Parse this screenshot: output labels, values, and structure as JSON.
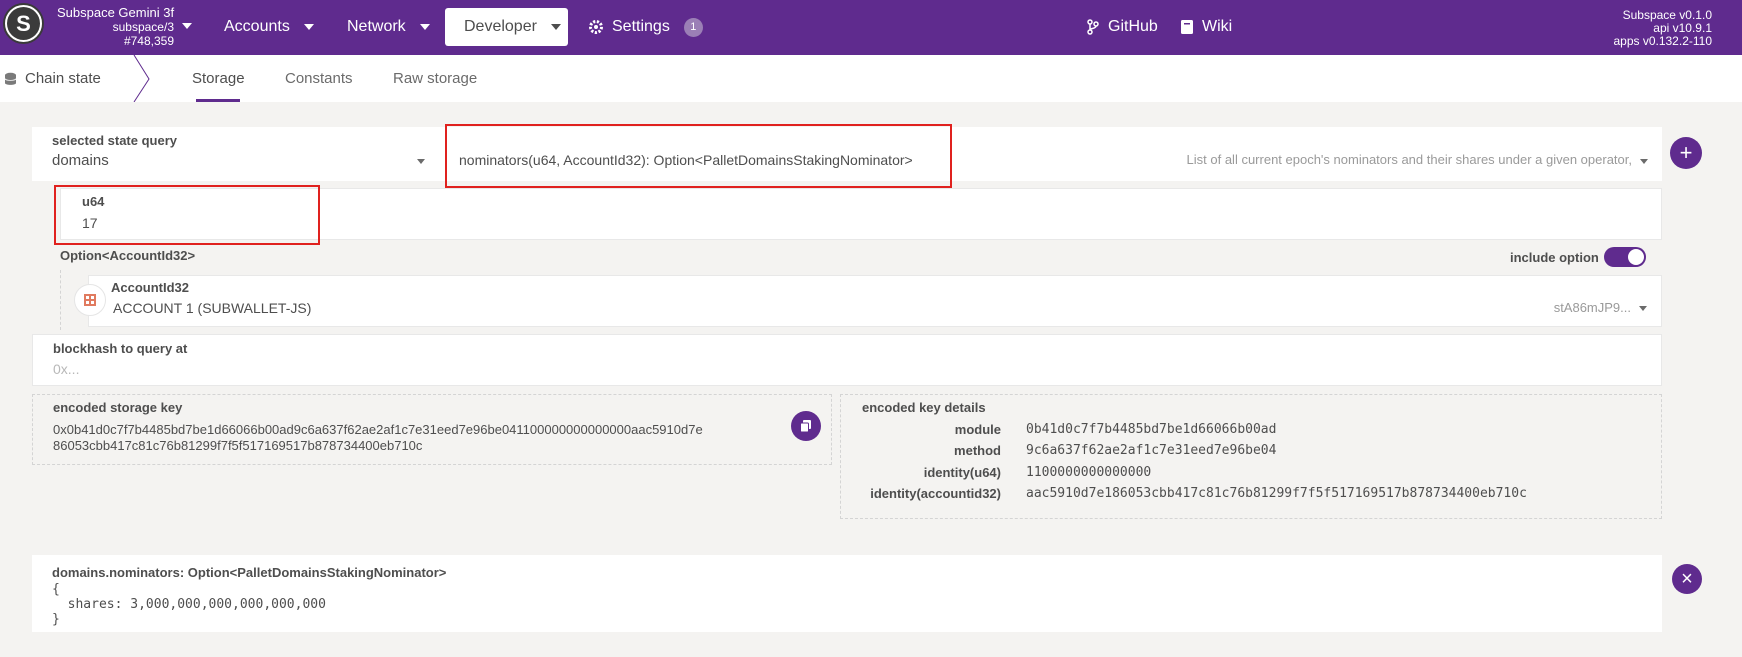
{
  "header": {
    "chain_name": "Subspace Gemini 3f",
    "chain_spec": "subspace/3",
    "block_number": "#748,359",
    "nav": [
      {
        "label": "Accounts"
      },
      {
        "label": "Network"
      },
      {
        "label": "Developer"
      },
      {
        "label": "Settings",
        "badge": "1"
      }
    ],
    "links": [
      {
        "label": "GitHub"
      },
      {
        "label": "Wiki"
      }
    ],
    "versions": [
      "Subspace v0.1.0",
      "api v10.9.1",
      "apps v0.132.2-110"
    ]
  },
  "subnav": {
    "title": "Chain state",
    "tabs": [
      {
        "label": "Storage"
      },
      {
        "label": "Constants"
      },
      {
        "label": "Raw storage"
      }
    ]
  },
  "query": {
    "label": "selected state query",
    "module": "domains",
    "method": "nominators(u64, AccountId32): Option<PalletDomainsStakingNominator>",
    "description": "List of all current epoch's nominators and their shares under a given operator,"
  },
  "param_u64": {
    "label": "u64",
    "value": "17"
  },
  "param_option": {
    "label": "Option<AccountId32>",
    "include_label": "include option",
    "account_label": "AccountId32",
    "account_name": "ACCOUNT 1 (SUBWALLET-JS)",
    "account_address": "stA86mJP9..."
  },
  "blockhash": {
    "label": "blockhash to query at",
    "placeholder": "0x..."
  },
  "encoded_key": {
    "label": "encoded storage key",
    "line1": "0x0b41d0c7f7b4485bd7be1d66066b00ad9c6a637f62ae2af1c7e31eed7e96be041100000000000000aac5910d7e",
    "line2": "86053cbb417c81c76b81299f7f5f517169517b878734400eb710c"
  },
  "key_details": {
    "label": "encoded key details",
    "rows": [
      {
        "key": "module",
        "value": "0b41d0c7f7b4485bd7be1d66066b00ad"
      },
      {
        "key": "method",
        "value": "9c6a637f62ae2af1c7e31eed7e96be04"
      },
      {
        "key": "identity(u64)",
        "value": "1100000000000000"
      },
      {
        "key": "identity(accountid32)",
        "value": "aac5910d7e186053cbb417c81c76b81299f7f5f517169517b878734400eb710c"
      }
    ]
  },
  "result": {
    "label": "domains.nominators: Option<PalletDomainsStakingNominator>",
    "open": "{",
    "shares_line": "  shares: 3,000,000,000,000,000,000",
    "close": "}"
  },
  "icons": {
    "add": "+",
    "remove": "×"
  }
}
